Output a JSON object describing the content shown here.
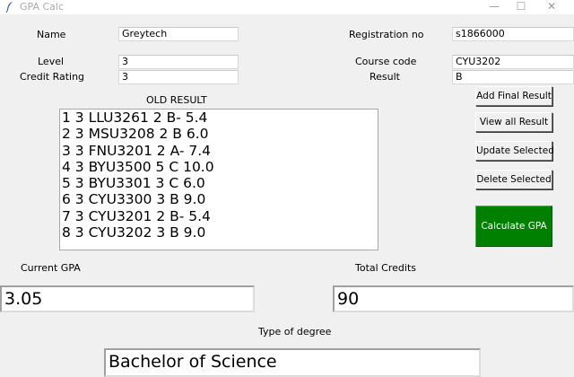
{
  "window": {
    "title": "GPA Calc",
    "minimize_glyph": "—",
    "maximize_glyph": "☐",
    "close_glyph": "✕"
  },
  "form": {
    "name_label": "Name",
    "name_value": "Greytech",
    "registration_label": "Registration no",
    "registration_value": "s1866000",
    "level_label": "Level",
    "level_value": "3",
    "course_code_label": "Course code",
    "course_code_value": "CYU3202",
    "credit_rating_label": "Credit Rating",
    "credit_rating_value": "3",
    "result_label": "Result",
    "result_value": "B"
  },
  "old_result": {
    "label": "OLD RESULT",
    "items": [
      "1 3 LLU3261 2 B- 5.4",
      "2 3 MSU3208 2 B 6.0",
      "3 3 FNU3201 2 A- 7.4",
      "4 3 BYU3500 5 C 10.0",
      "5 3 BYU3301 3 C 6.0",
      "6 3 CYU3300 3 B 9.0",
      "7 3 CYU3201 2 B- 5.4",
      "8 3 CYU3202 3 B 9.0"
    ]
  },
  "buttons": {
    "add_final": "Add Final Result",
    "view_all": "View all Result",
    "update": "Update Selected",
    "delete": "Delete Selected",
    "calculate": "Calculate GPA"
  },
  "summary": {
    "current_gpa_label": "Current GPA",
    "current_gpa_value": "3.05",
    "total_credits_label": "Total Credits",
    "total_credits_value": "90",
    "degree_label": "Type of degree",
    "degree_value": "Bachelor of Science"
  },
  "colors": {
    "calculate_bg": "#008000",
    "window_bg": "#f0f0f0"
  },
  "icons": {
    "app": "feather-icon"
  }
}
